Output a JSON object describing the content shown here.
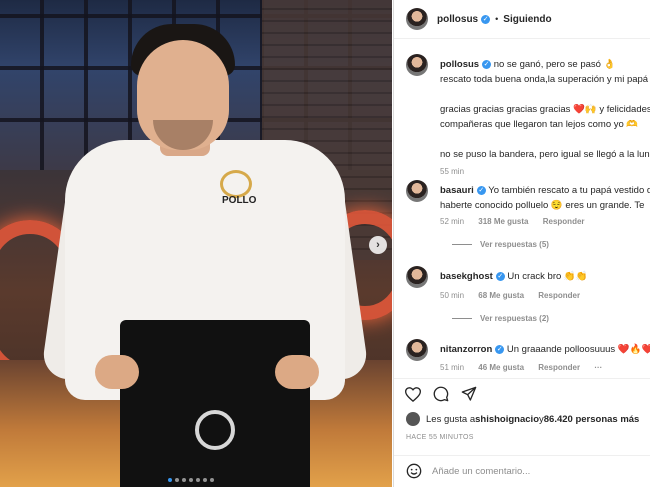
{
  "post": {
    "username": "pollosus",
    "follow_status": "Siguiendo",
    "separator": "•"
  },
  "caption": {
    "username": "pollosus",
    "line1": " no se ganó, pero se pasó 👌",
    "line2": "rescato toda buena onda,la superación y mi papá",
    "line3": "gracias gracias gracias gracias ❤️🙌 y felicidades",
    "line4": "compañeras que llegaron tan lejos como yo 🫶",
    "line5": "no se puso la bandera, pero igual se llegó a la lun",
    "time": "55 min"
  },
  "comments": [
    {
      "username": "basauri",
      "line1": " Yo también rescato a tu papá vestido d",
      "line2": "haberte conocido polluelo 😌 eres un grande. Te",
      "time": "52 min",
      "likes": "318 Me gusta",
      "reply": "Responder",
      "view_replies": "Ver respuestas (5)"
    },
    {
      "username": "basekghost",
      "line1": " Un crack bro 👏👏",
      "time": "50 min",
      "likes": "68 Me gusta",
      "reply": "Responder",
      "view_replies": "Ver respuestas (2)"
    },
    {
      "username": "nitanzorron",
      "line1": " Un graaande polloosuuus ❤️🔥❤️",
      "time": "51 min",
      "likes": "46 Me gusta",
      "reply": "Responder",
      "more": "···"
    }
  ],
  "likes_line": {
    "prefix": "Les gusta a ",
    "user": "shishoignacio",
    "middle": " y ",
    "count": "86.420 personas más"
  },
  "posted_ago": "HACE 55 MINUTOS",
  "add_comment": {
    "placeholder": "Añade un comentario..."
  },
  "photo": {
    "jacket_name": "POLLO",
    "carousel_total": 7,
    "carousel_active": 1
  },
  "colors": {
    "verified": "#3897f0",
    "muted": "#8e8e8e",
    "text": "#262626"
  }
}
